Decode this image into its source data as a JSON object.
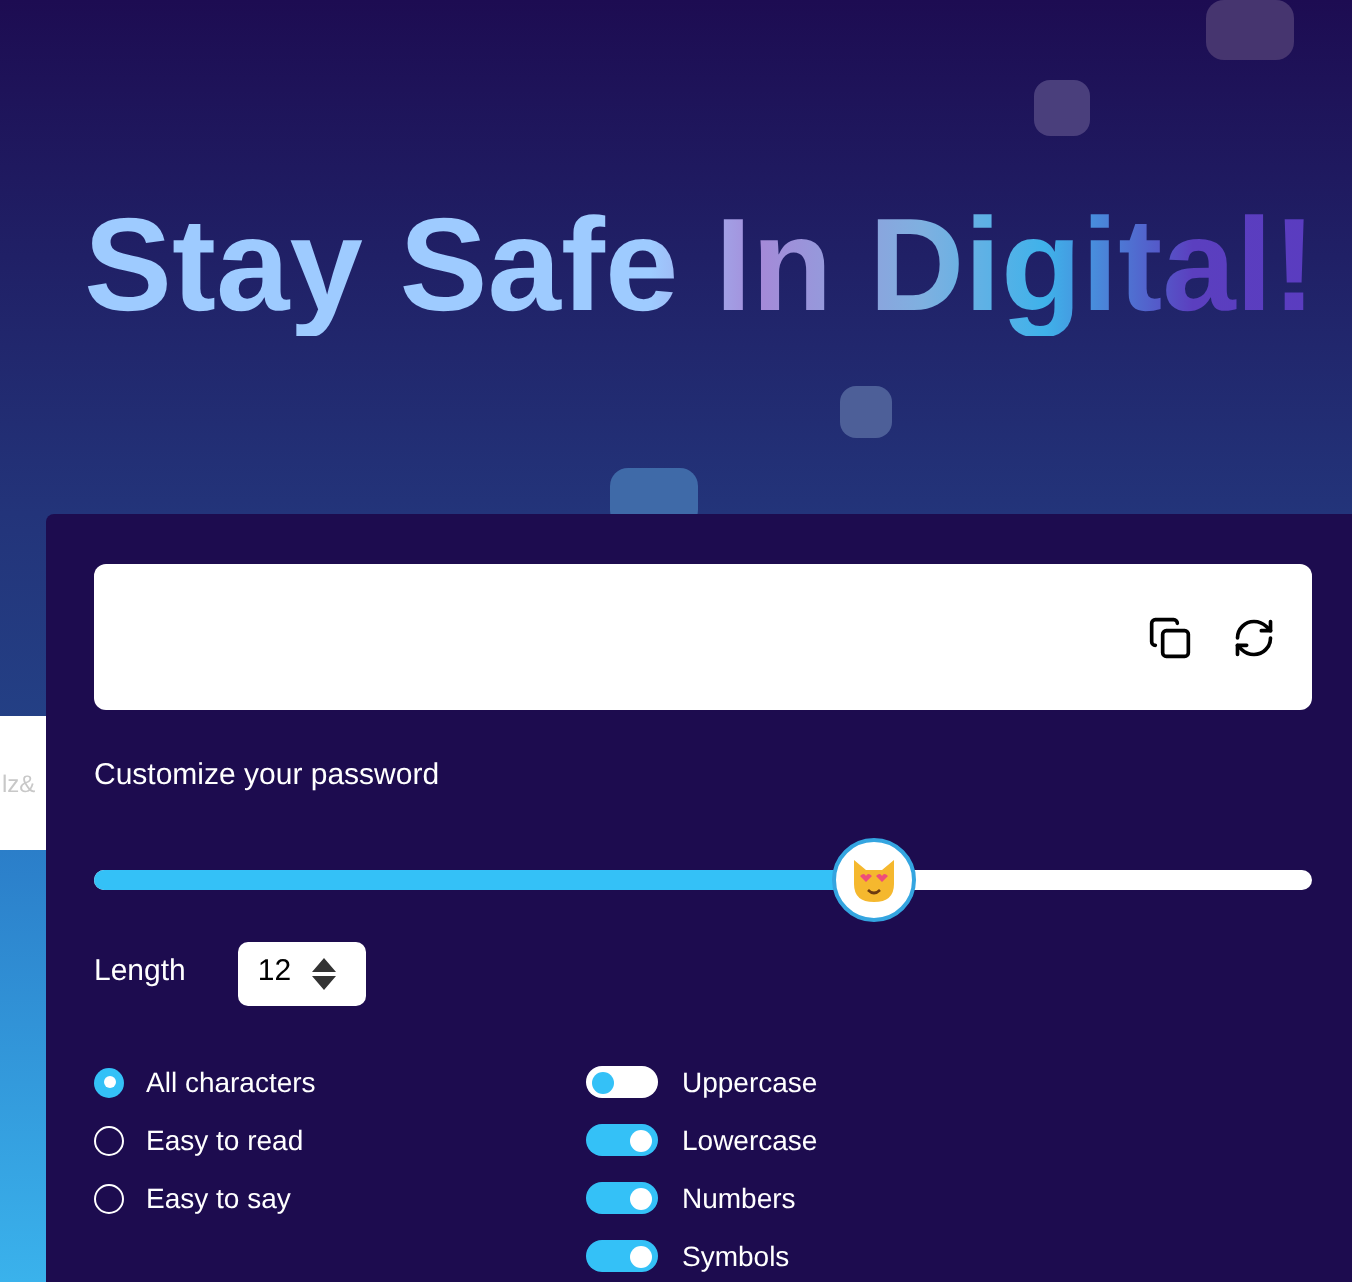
{
  "headline": "Stay Safe In Digital!",
  "background_card": {
    "text": "lz&"
  },
  "generator": {
    "actions": [
      {
        "kind": "copy"
      },
      {
        "kind": "refresh"
      }
    ],
    "customize_label": "Customize your password",
    "length_slider": {
      "level": 0.64
    },
    "length": {
      "label": "Length",
      "value": "12"
    },
    "modes": [
      {
        "label": "All characters",
        "selected": true
      },
      {
        "label": "Easy to read",
        "selected": false
      },
      {
        "label": "Easy to say",
        "selected": false
      }
    ],
    "character_sets": [
      {
        "label": "Uppercase",
        "on": false
      },
      {
        "label": "Lowercase",
        "on": true
      },
      {
        "label": "Numbers",
        "on": true
      },
      {
        "label": "Symbols",
        "on": true
      }
    ]
  }
}
